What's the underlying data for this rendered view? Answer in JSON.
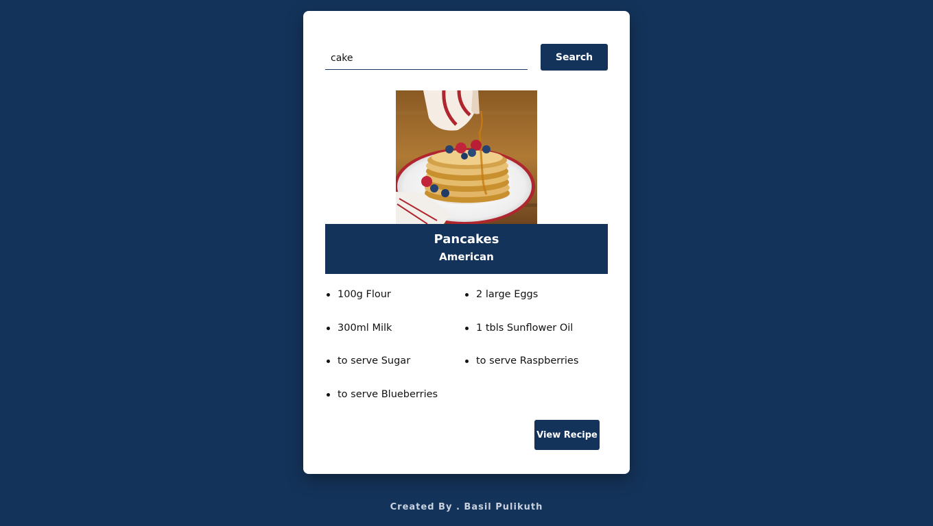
{
  "search": {
    "value": "cake",
    "button_label": "Search"
  },
  "meal": {
    "image_alt": "pancakes stack with berries and syrup",
    "name": "Pancakes",
    "area": "American",
    "ingredients": [
      "100g Flour",
      "2 large Eggs",
      "300ml Milk",
      "1 tbls Sunflower Oil",
      "to serve Sugar",
      "to serve Raspberries",
      "to serve Blueberries"
    ],
    "view_button_label": "View Recipe"
  },
  "footer": {
    "text": "Created By . Basil Pulikuth"
  },
  "colors": {
    "background": "#14335a",
    "card": "#ffffff",
    "accent": "#14335a"
  }
}
